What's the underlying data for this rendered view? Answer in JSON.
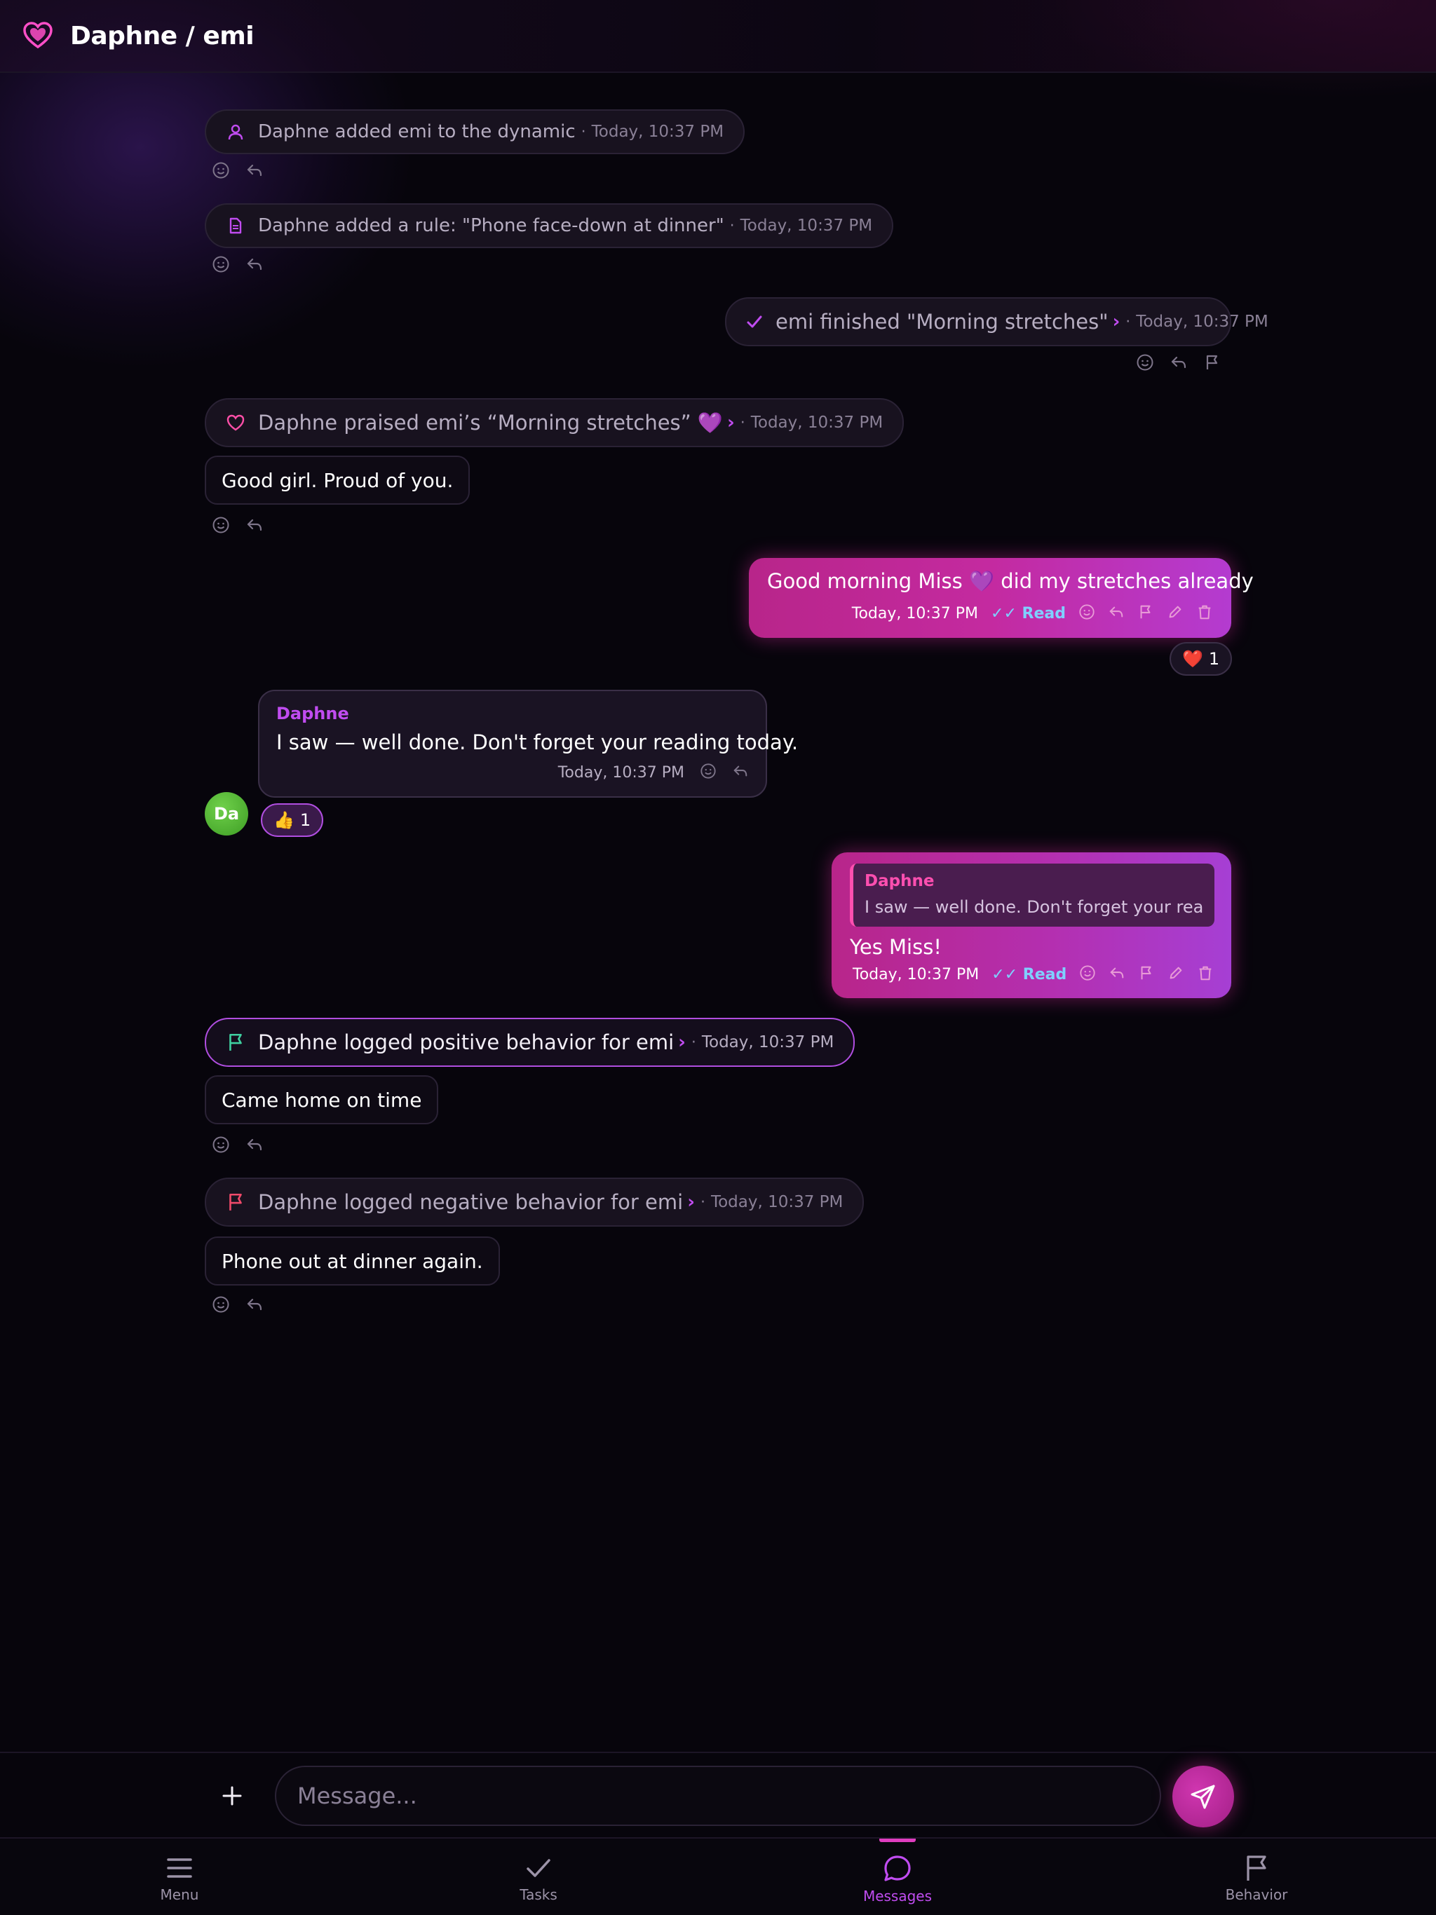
{
  "header": {
    "title": "Daphne / emi"
  },
  "events": [
    {
      "text": "Daphne added emi to the dynamic",
      "time": "Today, 10:37 PM"
    },
    {
      "text": "Daphne added a rule: \"Phone face-down at dinner\"",
      "time": "Today, 10:37 PM"
    },
    {
      "text": "emi finished \"Morning stretches\"",
      "time": "Today, 10:37 PM"
    },
    {
      "text": "Daphne praised emi’s “Morning stretches” 💜",
      "time": "Today, 10:37 PM",
      "note": "Good girl. Proud of you."
    },
    {
      "text": "Daphne logged positive behavior for emi",
      "time": "Today, 10:37 PM",
      "note": "Came home on time"
    },
    {
      "text": "Daphne logged negative behavior for emi",
      "time": "Today, 10:37 PM",
      "note": "Phone out at dinner again."
    }
  ],
  "messages": {
    "out1": {
      "text": "Good morning Miss 💜 did my stretches already",
      "time": "Today, 10:37 PM",
      "status": "✓✓ Read",
      "reaction_emoji": "❤️",
      "reaction_count": "1"
    },
    "in1": {
      "sender": "Daphne",
      "text": "I saw — well done. Don't forget your reading today.",
      "time": "Today, 10:37 PM",
      "reaction_emoji": "👍",
      "reaction_count": "1",
      "avatar": "Da"
    },
    "out2": {
      "quote_sender": "Daphne",
      "quote_text": "I saw — well done. Don't forget your rea...",
      "text": "Yes Miss!",
      "time": "Today, 10:37 PM",
      "status": "✓✓ Read"
    }
  },
  "composer": {
    "placeholder": "Message..."
  },
  "nav": [
    {
      "label": "Menu",
      "icon": "menu-icon"
    },
    {
      "label": "Tasks",
      "icon": "check-icon"
    },
    {
      "label": "Messages",
      "icon": "chat-bubble-icon"
    },
    {
      "label": "Behavior",
      "icon": "flag-icon"
    }
  ],
  "colors": {
    "accent_pink": "#e03dc0",
    "accent_purple": "#c04cf0",
    "background": "#07050c",
    "positive_flag": "#3fd0a0",
    "negative_flag": "#f04a6a",
    "read_status": "#7fd0ff"
  }
}
